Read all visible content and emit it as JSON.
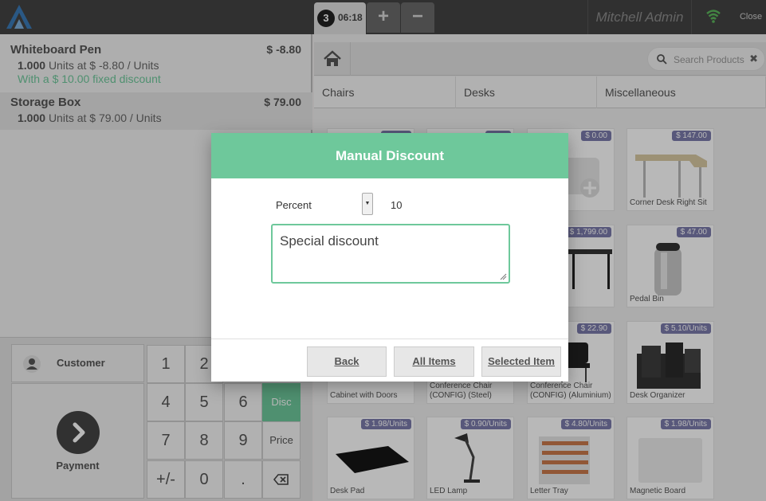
{
  "topbar": {
    "order_number": "3",
    "order_time": "06:18",
    "add_tab": "+",
    "remove_tab": "−",
    "user_name": "Mitchell Admin",
    "close_label": "Close"
  },
  "order": {
    "lines": [
      {
        "name": "Whiteboard Pen",
        "price": "$ -8.80",
        "qty": "1.000",
        "unit_text": "Units at $ -8.80 / Units",
        "discount_note": "With a $ 10.00 fixed discount"
      },
      {
        "name": "Storage Box",
        "price": "$ 79.00",
        "qty": "1.000",
        "unit_text": "Units at $ 79.00 / Units"
      }
    ]
  },
  "actionpad": {
    "customer_label": "Customer",
    "payment_label": "Payment"
  },
  "numpad": {
    "keys": [
      "1",
      "2",
      "4",
      "5",
      "6",
      "Disc",
      "7",
      "8",
      "9",
      "Price",
      "+/-",
      "0",
      "."
    ],
    "active_mode": "Disc"
  },
  "search": {
    "placeholder": "Search Products"
  },
  "categories": [
    "Chairs",
    "Desks",
    "Miscellaneous"
  ],
  "products": [
    {
      "name": "",
      "price": "$ 0.00"
    },
    {
      "name": "Corner Desk Right Sit",
      "price": "$ 147.00"
    },
    {
      "name": "",
      "price": "$ 1,799.00"
    },
    {
      "name": "Pedal Bin",
      "price": "$ 47.00"
    },
    {
      "name": "Cabinet with Doors",
      "price": ""
    },
    {
      "name": "Conference Chair (CONFIG) (Steel)",
      "price": ""
    },
    {
      "name": "Conference Chair (CONFIG) (Aluminium)",
      "price": "$ 22.90"
    },
    {
      "name": "Desk Organizer",
      "price": "$ 5.10/Units"
    },
    {
      "name": "Desk Pad",
      "price": "$ 1.98/Units"
    },
    {
      "name": "LED Lamp",
      "price": "$ 0.90/Units"
    },
    {
      "name": "Letter Tray",
      "price": "$ 4.80/Units"
    },
    {
      "name": "Magnetic Board",
      "price": "$ 1.98/Units"
    }
  ],
  "modal": {
    "title": "Manual Discount",
    "discount_type": "Percent",
    "discount_value": "10",
    "reason": "Special discount",
    "back_label": "Back",
    "all_items_label": "All Items",
    "selected_item_label": "Selected Item"
  },
  "colors": {
    "accent": "#6ec89b",
    "topbar": "#434343",
    "price_tag": "#7b7bab"
  }
}
